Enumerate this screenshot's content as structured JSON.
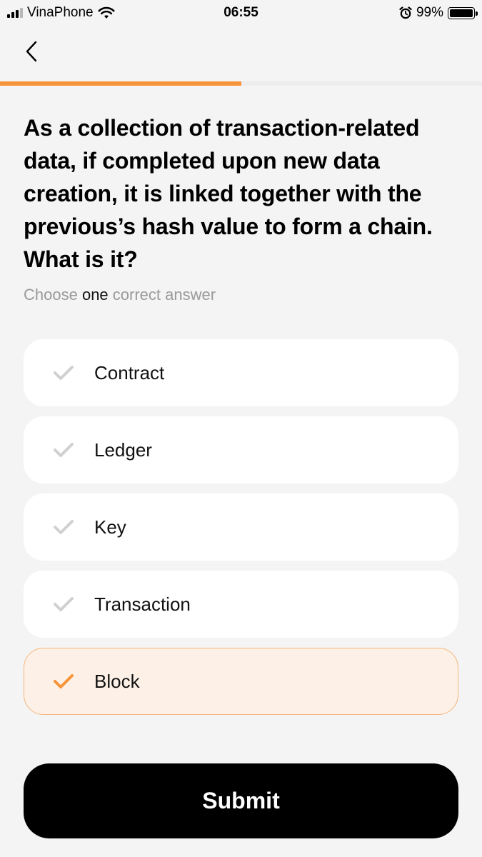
{
  "status_bar": {
    "carrier": "VinaPhone",
    "time": "06:55",
    "battery": "99%"
  },
  "progress": {
    "fraction": 0.5
  },
  "question": {
    "text": "As a collection of transaction-related data, if completed upon new data creation, it is linked together with the previous’s hash value to form a chain. What is it?",
    "hint_before": "Choose ",
    "hint_emphasis": "one",
    "hint_after": " correct answer"
  },
  "options": [
    {
      "label": "Contract",
      "selected": false
    },
    {
      "label": "Ledger",
      "selected": false
    },
    {
      "label": "Key",
      "selected": false
    },
    {
      "label": "Transaction",
      "selected": false
    },
    {
      "label": "Block",
      "selected": true
    }
  ],
  "submit_label": "Submit",
  "colors": {
    "accent": "#f7943a",
    "check_inactive": "#d0d0d0",
    "selected_bg": "#fdf1e7"
  }
}
